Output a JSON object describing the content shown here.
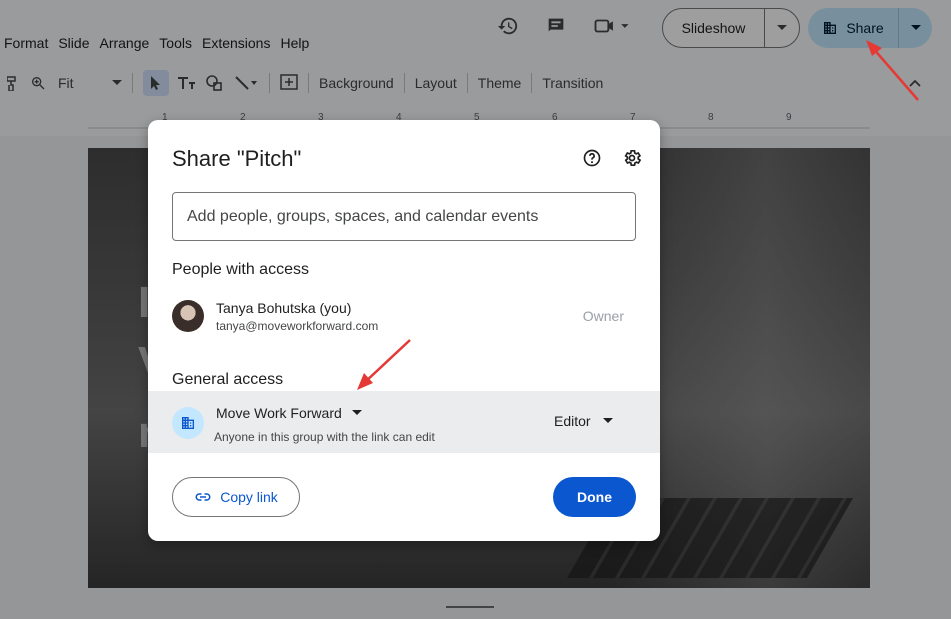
{
  "menu": [
    "Format",
    "Slide",
    "Arrange",
    "Tools",
    "Extensions",
    "Help"
  ],
  "header": {
    "slideshow_label": "Slideshow",
    "share_label": "Share"
  },
  "toolbar": {
    "zoom_value": "Fit",
    "background_label": "Background",
    "layout_label": "Layout",
    "theme_label": "Theme",
    "transition_label": "Transition"
  },
  "ruler": {
    "numbers": [
      "1",
      "2",
      "3",
      "4",
      "5",
      "6",
      "7",
      "8",
      "9"
    ]
  },
  "slide_letters": [
    "I",
    "V",
    "n"
  ],
  "dialog": {
    "title": "Share \"Pitch\"",
    "add_placeholder": "Add people, groups, spaces, and calendar events",
    "people_title": "People with access",
    "person": {
      "name": "Tanya Bohutska (you)",
      "email": "tanya@moveworkforward.com",
      "role": "Owner"
    },
    "general_title": "General access",
    "general": {
      "group_name": "Move Work Forward",
      "description": "Anyone in this group with the link can edit",
      "role": "Editor"
    },
    "copy_link_label": "Copy link",
    "done_label": "Done"
  },
  "colors": {
    "accent": "#0b57d0",
    "share_bg": "#c2e7ff",
    "annotation_arrow": "#e53935"
  }
}
